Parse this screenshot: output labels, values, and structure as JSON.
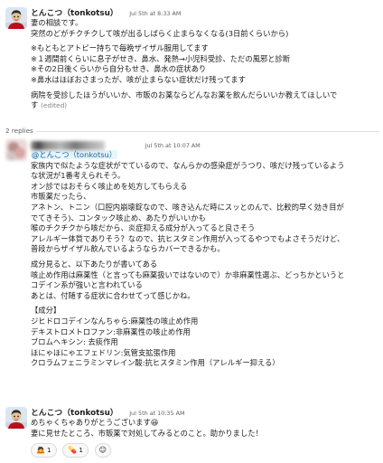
{
  "messages": [
    {
      "author": "とんこつ（tonkotsu）",
      "time": "Jul 5th at 8:33 AM",
      "paragraphs": [
        [
          "妻の相談です。",
          "突然のどがチクチクして咳が出るしばらく止まらなくなる(3日前くらいから)"
        ],
        [
          "※もともとアトピー持ちで毎晩ザイザル服用してます",
          "※１週間前くらいに息子がせき、鼻水、発熱→小児科受診、ただの風邪と診断",
          "※その2日後くらいから自分もせき、鼻水の症状あり",
          "※鼻水はほぼおさまったが、咳が止まらない症状だけ残ってます"
        ],
        [
          "病院を受診したほうがいいか、市販のお薬ならどんなお薬を飲んだらいいか教えてほしいで",
          "す"
        ]
      ],
      "edited": "(edited)"
    },
    {
      "time": "Jul 5th at 10:07 AM",
      "mention": "@とんこつ（tonkotsu）",
      "paragraphs": [
        [
          "家族内で似たような症状がでているので、なんらかの感染症がうつり、咳だけ残っているよう",
          "な状況が1番考えられそう。",
          "オン診ではおそらく咳止めを処方してもらえる",
          "市販薬だったら、",
          "アネトン、トニン（口腔内崩壊錠なので、咳き込んだ時にスッとのんで、比較的早く効き目が",
          "でてきそう)、コンタック咳止め、あたりがいいかも",
          "喉のチクチクから咳だから、炎症抑える成分が入ってると良さそう",
          "アレルギー体質でありそう？なので、抗ヒスタミン作用が入ってるやつでもよさそうだけど、",
          "普段からザイザル飲んでいるようならカバーできるかも。"
        ],
        [
          "成分見ると、以下あたりが書いてある",
          "咳止め作用は麻薬性（と言っても麻薬扱いではないので）か非麻薬性選ぶ、どっちかというと",
          "コデイン系が強いと言われている",
          "あとは、付随する症状に合わせてって感じかね。"
        ],
        [
          "【成分】",
          "ジヒドロコデインなんちゃら:麻薬性の咳止め作用",
          "デキストロメトロファン:非麻薬性の咳止め作用",
          "ブロムヘキシン: 去痰作用",
          "ほにゃほにゃエフェドリン:気管支拡張作用",
          "クロラムフェニラミンマレイン酸:抗ヒスタミン作用（アレルギー抑える）"
        ]
      ]
    },
    {
      "author": "とんこつ（tonkotsu）",
      "time": "Jul 5th at 10:35 AM",
      "paragraphs": [
        [
          "めちゃくちゃありがとうございます😆",
          "妻に見せたところ、市販薬で対処してみるとのこと。助かりました！"
        ]
      ]
    }
  ],
  "replies_label": "2 replies",
  "reactions": [
    {
      "icon": "bow-emoji-icon",
      "glyph": "🙇",
      "count": "1"
    },
    {
      "icon": "pill-emoji-icon",
      "glyph": "💊",
      "count": "1"
    },
    {
      "icon": "add-reaction-icon",
      "glyph": "☺"
    }
  ],
  "colors": {
    "mention_bg": "#e8f5fa",
    "mention_text": "#1264a3",
    "muted_text": "#616061",
    "divider": "#dddddd"
  }
}
